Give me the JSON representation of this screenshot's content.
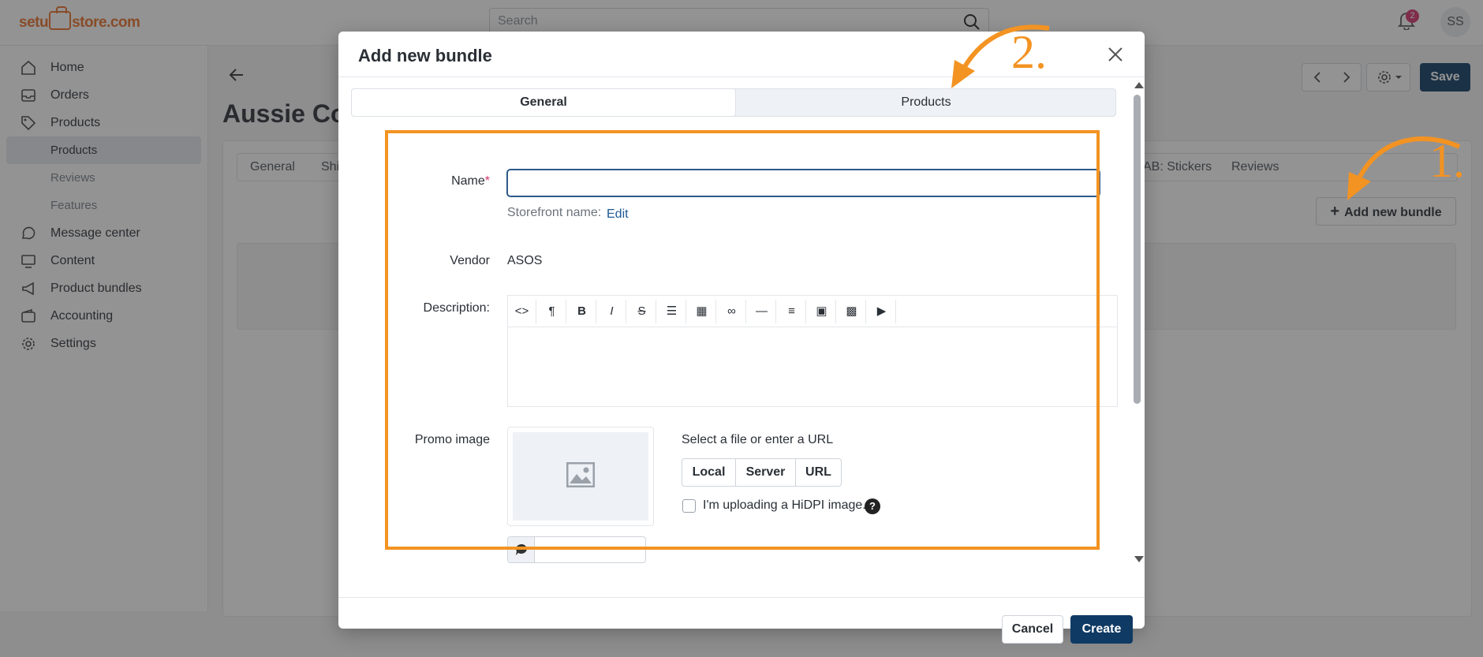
{
  "app": {
    "logo": "setustore.com",
    "search_placeholder": "Search",
    "notification_count": "2",
    "avatar_initials": "SS"
  },
  "sidebar": {
    "items": [
      {
        "label": "Home",
        "icon": "home-icon"
      },
      {
        "label": "Orders",
        "icon": "inbox-icon"
      },
      {
        "label": "Products",
        "icon": "tag-icon"
      },
      {
        "label": "Message center",
        "icon": "chat-icon"
      },
      {
        "label": "Content",
        "icon": "monitor-icon"
      },
      {
        "label": "Product bundles",
        "icon": "megaphone-icon"
      },
      {
        "label": "Accounting",
        "icon": "wallet-icon"
      },
      {
        "label": "Settings",
        "icon": "gear-icon"
      }
    ],
    "products_sub": [
      "Products",
      "Reviews",
      "Features"
    ]
  },
  "page": {
    "title": "Aussie Co",
    "save_label": "Save",
    "tabs": [
      "General",
      "Shi",
      "AB: Stickers",
      "Reviews"
    ],
    "add_bundle_label": "Add new bundle"
  },
  "modal": {
    "title": "Add new bundle",
    "tabs": [
      "General",
      "Products"
    ],
    "active_tab": "General",
    "name_label": "Name",
    "name_required_mark": "*",
    "name_value": "",
    "storefront_label": "Storefront name:",
    "storefront_edit": "Edit",
    "vendor_label": "Vendor",
    "vendor_value": "ASOS",
    "description_label": "Description:",
    "toolbar": [
      "code-view",
      "paragraph",
      "bold",
      "italic",
      "strikethrough",
      "bullet-list",
      "table",
      "link",
      "horizontal-rule",
      "align",
      "text-color",
      "image",
      "video"
    ],
    "promo_label": "Promo image",
    "source_label": "Select a file or enter a URL",
    "source_buttons": [
      "Local",
      "Server",
      "URL"
    ],
    "hidpi_label": "I'm uploading a HiDPI image.",
    "help_glyph": "?",
    "cancel_label": "Cancel",
    "create_label": "Create"
  },
  "annotations": {
    "step_1": "1.",
    "step_2": "2.",
    "color": "#f39322"
  }
}
